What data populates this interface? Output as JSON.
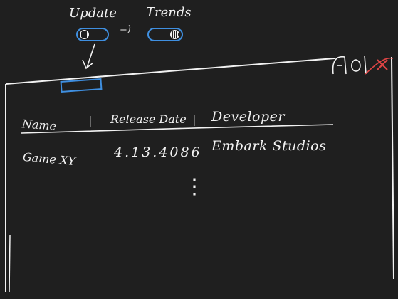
{
  "toolbar": {
    "update_label": "Update",
    "trends_label": "Trends",
    "arrow_glyph": "=)"
  },
  "window": {
    "minimize_glyph": "-",
    "maximize_glyph": "▢",
    "close_glyph": "×"
  },
  "table": {
    "columns": [
      "Name",
      "Release Date",
      "Developer"
    ],
    "separator": "|",
    "rows": [
      {
        "name": "Game XY",
        "release_date": "4.13.4086",
        "developer": "Embark Studios"
      }
    ],
    "more_indicator": "⋮"
  },
  "colors": {
    "background": "#1f1f1f",
    "ink": "#f2f2f2",
    "accent_blue": "#3f8fe0",
    "close_red": "#e04545"
  }
}
